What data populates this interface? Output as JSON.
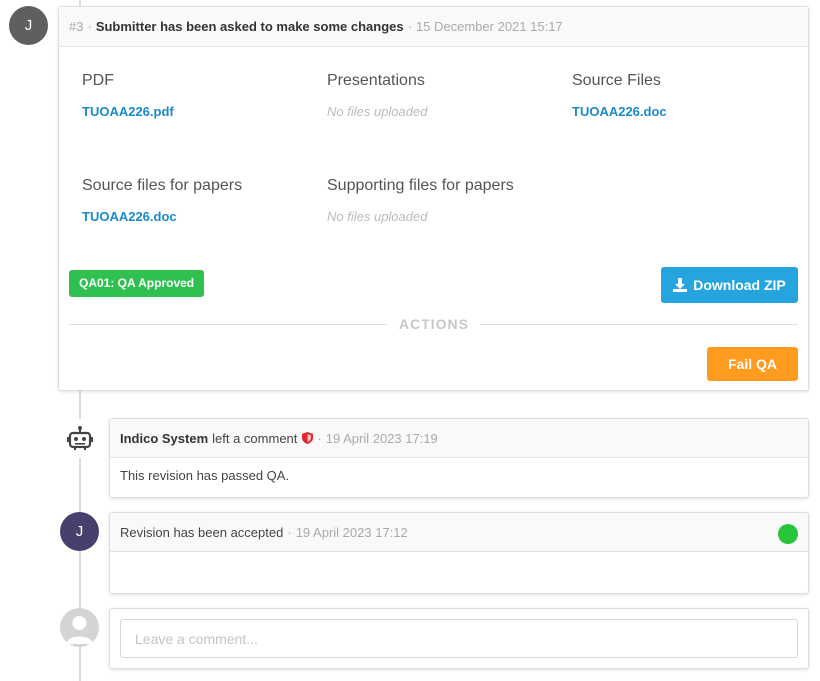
{
  "revision": {
    "number": "#3",
    "title": "Submitter has been asked to make some changes",
    "timestamp": "15 December 2021 15:17",
    "avatar_initial": "J",
    "avatar_color": "#5f5f5f"
  },
  "files": [
    {
      "title": "PDF",
      "value": "TUOAA226.pdf",
      "empty": false
    },
    {
      "title": "Presentations",
      "value": "No files uploaded",
      "empty": true
    },
    {
      "title": "Source Files",
      "value": "TUOAA226.doc",
      "empty": false
    },
    {
      "title": "Source files for papers",
      "value": "TUOAA226.doc",
      "empty": false
    },
    {
      "title": "Supporting files for papers",
      "value": "No files uploaded",
      "empty": true
    }
  ],
  "qa_tag": {
    "label": "QA01: QA Approved",
    "color": "#30c050"
  },
  "download_button": {
    "label": "Download ZIP",
    "icon": "download-icon",
    "color": "#25a4dd"
  },
  "actions_label": "ACTIONS",
  "fail_button": {
    "label": "Fail QA",
    "color": "#ff9b1e"
  },
  "comment_item": {
    "author": "Indico System",
    "action": "left a comment",
    "timestamp": "19 April 2023 17:19",
    "body": "This revision has passed QA.",
    "icon": "robot-icon",
    "badge_icon": "shield-icon"
  },
  "accepted_item": {
    "text": "Revision has been accepted",
    "timestamp": "19 April 2023 17:12",
    "avatar_initial": "J",
    "avatar_color": "#45406c",
    "status_color": "#27c53a"
  },
  "new_comment": {
    "placeholder": "Leave a comment..."
  },
  "separator": "·"
}
